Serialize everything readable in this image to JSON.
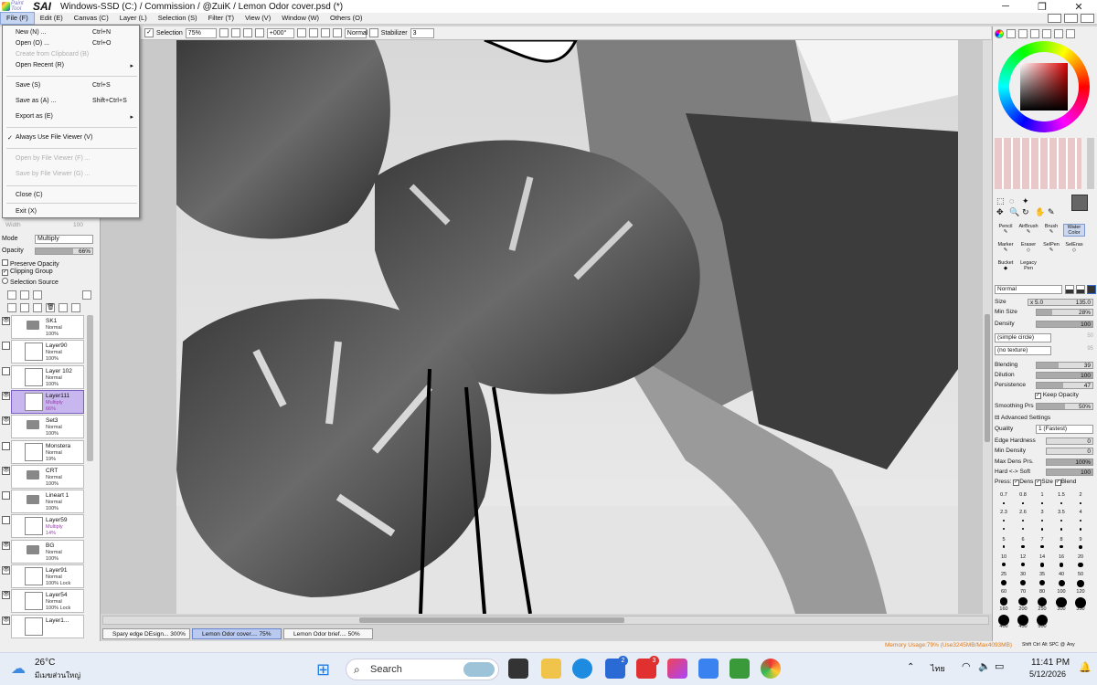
{
  "window": {
    "brand": "Paint Tool",
    "app_name": "SAI",
    "title": "Windows-SSD (C:) / Commission / @ZuiK / Lemon Odor cover.psd (*)"
  },
  "menubar": [
    "File (F)",
    "Edit (E)",
    "Canvas (C)",
    "Layer (L)",
    "Selection (S)",
    "Filter (T)",
    "View (V)",
    "Window (W)",
    "Others (O)"
  ],
  "file_menu": {
    "new": "New (N) ...",
    "new_sc": "Ctrl+N",
    "open": "Open (O) ...",
    "open_sc": "Ctrl+O",
    "create_clip": "Create from Clipboard (B)",
    "open_recent": "Open Recent (R)",
    "save": "Save (S)",
    "save_sc": "Ctrl+S",
    "save_as": "Save as (A) ...",
    "save_as_sc": "Shift+Ctrl+S",
    "export_as": "Export as (E)",
    "always_viewer": "Always Use File Viewer (V)",
    "open_viewer": "Open by File Viewer (F) ...",
    "save_viewer": "Save by File Viewer (G) ...",
    "close": "Close (C)",
    "exit": "Exit (X)"
  },
  "toolbar": {
    "selection": "Selection",
    "zoom": "75%",
    "angle": "+000°",
    "blend": "Normal",
    "stabilizer_label": "Stabilizer",
    "stabilizer_value": "3"
  },
  "layer_panel": {
    "width_label": "Width",
    "width_value": "100",
    "mode_label": "Mode",
    "mode_value": "Multiply",
    "opacity_label": "Opacity",
    "opacity_value": "66%",
    "opacity_frac": 0.66,
    "preserve_opacity": "Preserve Opacity",
    "clipping_group": "Clipping Group",
    "selection_source": "Selection Source"
  },
  "layers": [
    {
      "name": "SK1",
      "mode": "Normal",
      "opacity": "100%",
      "kind": "folder",
      "eye": true
    },
    {
      "name": "Layer90",
      "mode": "Normal",
      "opacity": "100%",
      "kind": "layer",
      "eye": false
    },
    {
      "name": "Layer 102",
      "mode": "Normal",
      "opacity": "100%",
      "kind": "layer",
      "eye": false
    },
    {
      "name": "Layer111",
      "mode": "Multiply",
      "opacity": "66%",
      "kind": "layer",
      "eye": true,
      "selected": true
    },
    {
      "name": "Set3",
      "mode": "Normal",
      "opacity": "100%",
      "kind": "folder",
      "eye": true
    },
    {
      "name": "Monstera",
      "mode": "Normal",
      "opacity": "19%",
      "kind": "layer",
      "eye": false
    },
    {
      "name": "CRT",
      "mode": "Normal",
      "opacity": "100%",
      "kind": "folder",
      "eye": true
    },
    {
      "name": "Lineart 1",
      "mode": "Normal",
      "opacity": "100%",
      "kind": "folder",
      "eye": false
    },
    {
      "name": "Layer59",
      "mode": "Multiply",
      "opacity": "14%",
      "kind": "layer",
      "eye": false
    },
    {
      "name": "BG",
      "mode": "Normal",
      "opacity": "100%",
      "kind": "folder",
      "eye": true
    },
    {
      "name": "Layer91",
      "mode": "Normal",
      "opacity": "100% Lock",
      "kind": "layer",
      "eye": true
    },
    {
      "name": "Layer54",
      "mode": "Normal",
      "opacity": "100% Lock",
      "kind": "layer",
      "eye": true
    },
    {
      "name": "Layer1...",
      "mode": "",
      "opacity": "",
      "kind": "layer",
      "eye": true
    }
  ],
  "tools": [
    "Pencil",
    "AirBrush",
    "Brush",
    "Water Color",
    "Marker",
    "Eraser",
    "SelPen",
    "SelEras",
    "Bucket",
    "Legacy Pen"
  ],
  "brush": {
    "blend_mode": "Normal",
    "size_label": "Size",
    "size_mult": "x 5.0",
    "size_value": "135.0",
    "minsize_label": "Min Size",
    "minsize_value": "28%",
    "minsize_frac": 0.28,
    "density_label": "Density",
    "density_value": "100",
    "density_frac": 1.0,
    "shape": "(simple circle)",
    "shape_value": "50",
    "texture": "(no texture)",
    "texture_value": "95",
    "blending_label": "Blending",
    "blending_value": "39",
    "blending_frac": 0.39,
    "dilution_label": "Dilution",
    "dilution_value": "100",
    "dilution_frac": 1.0,
    "persistence_label": "Persistence",
    "persistence_value": "47",
    "persistence_frac": 0.47,
    "keep_opacity": "Keep Opacity",
    "smoothing_label": "Smoothing Prs",
    "smoothing_value": "50%",
    "smoothing_frac": 0.5,
    "advanced": "Advanced Settings",
    "quality_label": "Quality",
    "quality_value": "1 (Fastest)",
    "edge_label": "Edge Hardness",
    "edge_value": "0",
    "mindens_label": "Min Density",
    "mindens_value": "0",
    "maxdens_label": "Max Dens Prs.",
    "maxdens_value": "100%",
    "hardsoft_label": "Hard <-> Soft",
    "hardsoft_value": "100",
    "press_label": "Press:",
    "press_dens": "Dens",
    "press_size": "Size",
    "press_blend": "Blend"
  },
  "brush_sizes": [
    "0.7",
    "0.8",
    "1",
    "1.5",
    "2",
    "2.3",
    "2.6",
    "3",
    "3.5",
    "4",
    "5",
    "6",
    "7",
    "8",
    "9",
    "10",
    "12",
    "14",
    "16",
    "20",
    "25",
    "30",
    "35",
    "40",
    "50",
    "60",
    "70",
    "80",
    "100",
    "120",
    "160",
    "200",
    "250",
    "300",
    "350",
    "400",
    "450",
    "500"
  ],
  "tabs": [
    {
      "label": "Spary edge DEsign...",
      "zoom": "300%"
    },
    {
      "label": "Lemon Odor cover....",
      "zoom": "75%",
      "active": true
    },
    {
      "label": "Lemon Odor brief....",
      "zoom": "50%"
    }
  ],
  "status": {
    "memory": "Memory Usage:79% (Use3245MB/Max4093MB)",
    "keys": [
      "Shift",
      "Ctrl",
      "Alt",
      "SPC",
      "@",
      "Any"
    ]
  },
  "taskbar": {
    "temp": "26°C",
    "weather": "มีเมฆส่วนใหญ่",
    "search": "Search",
    "lang": "ไทย",
    "time": "11:41 PM",
    "date": "5/12/2026",
    "badge1": "2",
    "badge2": "3"
  },
  "colors": {
    "accent": "#3a6ad0",
    "selected_layer": "#c8b6ee",
    "active_tab": "#b9c9ef"
  }
}
